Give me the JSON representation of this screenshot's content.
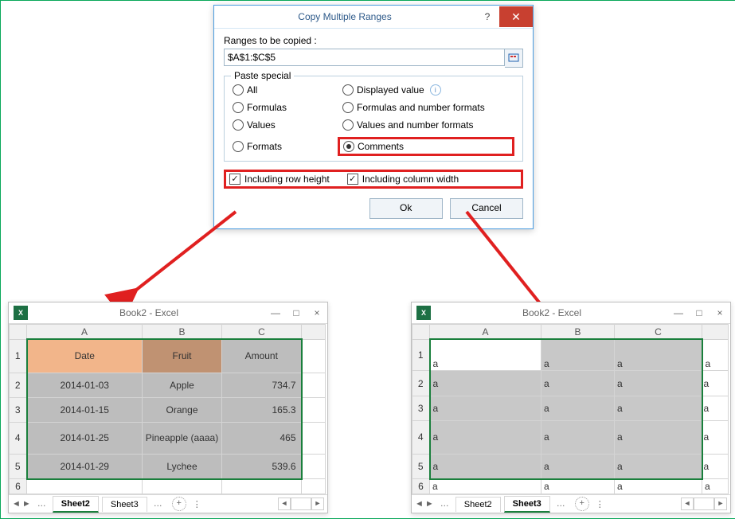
{
  "dialog": {
    "title": "Copy Multiple Ranges",
    "help_symbol": "?",
    "close_symbol": "✕",
    "ranges_label": "Ranges to be copied :",
    "ranges_value": "$A$1:$C$5",
    "paste_special_legend": "Paste special",
    "options": {
      "all": "All",
      "formulas": "Formulas",
      "values": "Values",
      "formats": "Formats",
      "displayed": "Displayed value",
      "formulas_num": "Formulas and number formats",
      "values_num": "Values and number formats",
      "comments": "Comments"
    },
    "selected_option": "comments",
    "include_row_height": "Including row height",
    "include_col_width": "Including column width",
    "include_row_height_checked": true,
    "include_col_width_checked": true,
    "ok": "Ok",
    "cancel": "Cancel",
    "info_glyph": "i"
  },
  "checkmark": "✓",
  "excel": {
    "title": "Book2 - Excel",
    "logo_text": "X",
    "win_min": "—",
    "win_max": "□",
    "win_close": "×",
    "scroll_left": "◄",
    "scroll_right": "►",
    "nav_prev": "◄",
    "nav_next": "►",
    "tab_dots": "…",
    "tab_plus": "+",
    "sheet2": "Sheet2",
    "sheet3": "Sheet3"
  },
  "left": {
    "cols": [
      "A",
      "B",
      "C"
    ],
    "header": {
      "date": "Date",
      "fruit": "Fruit",
      "amount": "Amount"
    },
    "rows": [
      {
        "r": "1"
      },
      {
        "r": "2",
        "date": "2014-01-03",
        "fruit": "Apple",
        "amount": "734.7"
      },
      {
        "r": "3",
        "date": "2014-01-15",
        "fruit": "Orange",
        "amount": "165.3"
      },
      {
        "r": "4",
        "date": "2014-01-25",
        "fruit": "Pineapple (aaaa)",
        "amount": "465"
      },
      {
        "r": "5",
        "date": "2014-01-29",
        "fruit": "Lychee",
        "amount": "539.6"
      },
      {
        "r": "6"
      }
    ]
  },
  "right": {
    "cols": [
      "A",
      "B",
      "C"
    ],
    "filler": "a",
    "rows": [
      "1",
      "2",
      "3",
      "4",
      "5",
      "6"
    ]
  }
}
